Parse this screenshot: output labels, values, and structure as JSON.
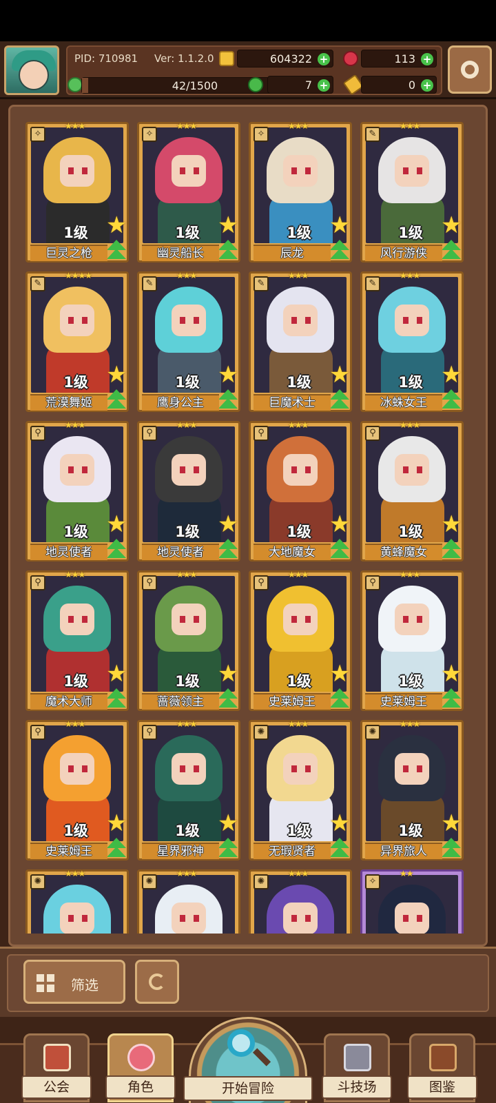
{
  "header": {
    "pid": "PID: 710981",
    "version": "Ver: 1.1.2.0",
    "gold": "604322",
    "gems": "113",
    "energy": "42/1500",
    "energy_fraction": 0.028,
    "clover": "7",
    "keys": "0"
  },
  "cards": [
    {
      "name": "巨灵之枪",
      "level": "1级",
      "stars": "★★★",
      "class_icon": "✧",
      "hair": "#e8b64a",
      "body": "#2b2b2b",
      "frame": "gold"
    },
    {
      "name": "幽灵船长",
      "level": "1级",
      "stars": "★★★",
      "class_icon": "✧",
      "hair": "#d44a6a",
      "body": "#2e5a4a",
      "frame": "gold"
    },
    {
      "name": "辰龙",
      "level": "1级",
      "stars": "★★★",
      "class_icon": "✧",
      "hair": "#e8dcc6",
      "body": "#3a8fc0",
      "frame": "gold"
    },
    {
      "name": "风行游侠",
      "level": "1级",
      "stars": "★★★",
      "class_icon": "✎",
      "hair": "#e6e4e4",
      "body": "#4a6a3a",
      "frame": "gold"
    },
    {
      "name": "荒漠舞姬",
      "level": "1级",
      "stars": "★★★★",
      "class_icon": "✎",
      "hair": "#f0c060",
      "body": "#c03a2a",
      "frame": "gold"
    },
    {
      "name": "鹰身公主",
      "level": "1级",
      "stars": "★★★",
      "class_icon": "✎",
      "hair": "#5ed0d8",
      "body": "#4a5a6a",
      "frame": "gold"
    },
    {
      "name": "巨魔术士",
      "level": "1级",
      "stars": "★★★",
      "class_icon": "✎",
      "hair": "#e4e4f0",
      "body": "#7a5a3a",
      "frame": "gold"
    },
    {
      "name": "冰蛛女王",
      "level": "1级",
      "stars": "★★★",
      "class_icon": "✎",
      "hair": "#6ed0e0",
      "body": "#2a6a7a",
      "frame": "gold"
    },
    {
      "name": "地灵使者",
      "level": "1级",
      "stars": "★★★",
      "class_icon": "⚲",
      "hair": "#eae6f2",
      "body": "#5a8a3a",
      "frame": "gold"
    },
    {
      "name": "地灵使者",
      "level": "1级",
      "stars": "★★★",
      "class_icon": "⚲",
      "hair": "#3a3a3a",
      "body": "#1e2a3a",
      "frame": "gold"
    },
    {
      "name": "大地魔女",
      "level": "1级",
      "stars": "★★★",
      "class_icon": "⚲",
      "hair": "#d0703a",
      "body": "#8a3a2a",
      "frame": "gold"
    },
    {
      "name": "黄蜂魔女",
      "level": "1级",
      "stars": "★★★",
      "class_icon": "⚲",
      "hair": "#e8e8e8",
      "body": "#c07a2a",
      "frame": "gold"
    },
    {
      "name": "魔术大师",
      "level": "1级",
      "stars": "★★★",
      "class_icon": "⚲",
      "hair": "#3aa08a",
      "body": "#b03030",
      "frame": "gold"
    },
    {
      "name": "蔷薇领主",
      "level": "1级",
      "stars": "★★★",
      "class_icon": "⚲",
      "hair": "#6a9a4a",
      "body": "#2a5a3a",
      "frame": "gold"
    },
    {
      "name": "史莱姆王",
      "level": "1级",
      "stars": "★★★",
      "class_icon": "⚲",
      "hair": "#f0c030",
      "body": "#d8a020",
      "frame": "gold"
    },
    {
      "name": "史莱姆王",
      "level": "1级",
      "stars": "★★★",
      "class_icon": "⚲",
      "hair": "#f0f4f8",
      "body": "#cfe2ea",
      "frame": "gold"
    },
    {
      "name": "史莱姆王",
      "level": "1级",
      "stars": "★★★",
      "class_icon": "⚲",
      "hair": "#f4a030",
      "body": "#e05a20",
      "frame": "gold"
    },
    {
      "name": "星界邪神",
      "level": "1级",
      "stars": "★★★",
      "class_icon": "⚲",
      "hair": "#2a6a5a",
      "body": "#1e4a40",
      "frame": "gold"
    },
    {
      "name": "无瑕贤者",
      "level": "1级",
      "stars": "★★★",
      "class_icon": "✺",
      "hair": "#f2d890",
      "body": "#e6e6f0",
      "frame": "gold"
    },
    {
      "name": "异界旅人",
      "level": "1级",
      "stars": "★★★",
      "class_icon": "✺",
      "hair": "#2a3040",
      "body": "#6a4a2a",
      "frame": "gold"
    },
    {
      "name": "",
      "level": "",
      "stars": "★★★",
      "class_icon": "✺",
      "hair": "#6ad0e0",
      "body": "#4aa0c0",
      "frame": "gold"
    },
    {
      "name": "",
      "level": "",
      "stars": "★★★",
      "class_icon": "✺",
      "hair": "#e8eef4",
      "body": "#c0c8d0",
      "frame": "gold"
    },
    {
      "name": "",
      "level": "",
      "stars": "★★★",
      "class_icon": "✺",
      "hair": "#6a4ab0",
      "body": "#3a3a9a",
      "frame": "gold"
    },
    {
      "name": "",
      "level": "",
      "stars": "★★",
      "class_icon": "✧",
      "hair": "#202840",
      "body": "#3a5a3a",
      "frame": "purple"
    }
  ],
  "controls": {
    "filter_label": "筛选"
  },
  "nav": {
    "guild": "公会",
    "character": "角色",
    "adventure": "开始冒险",
    "arena": "斗技场",
    "codex": "图鉴"
  },
  "colors": {
    "plus_green": "#48c24a",
    "card_gold": "#e1a64a",
    "card_purple": "#b58ad8"
  }
}
